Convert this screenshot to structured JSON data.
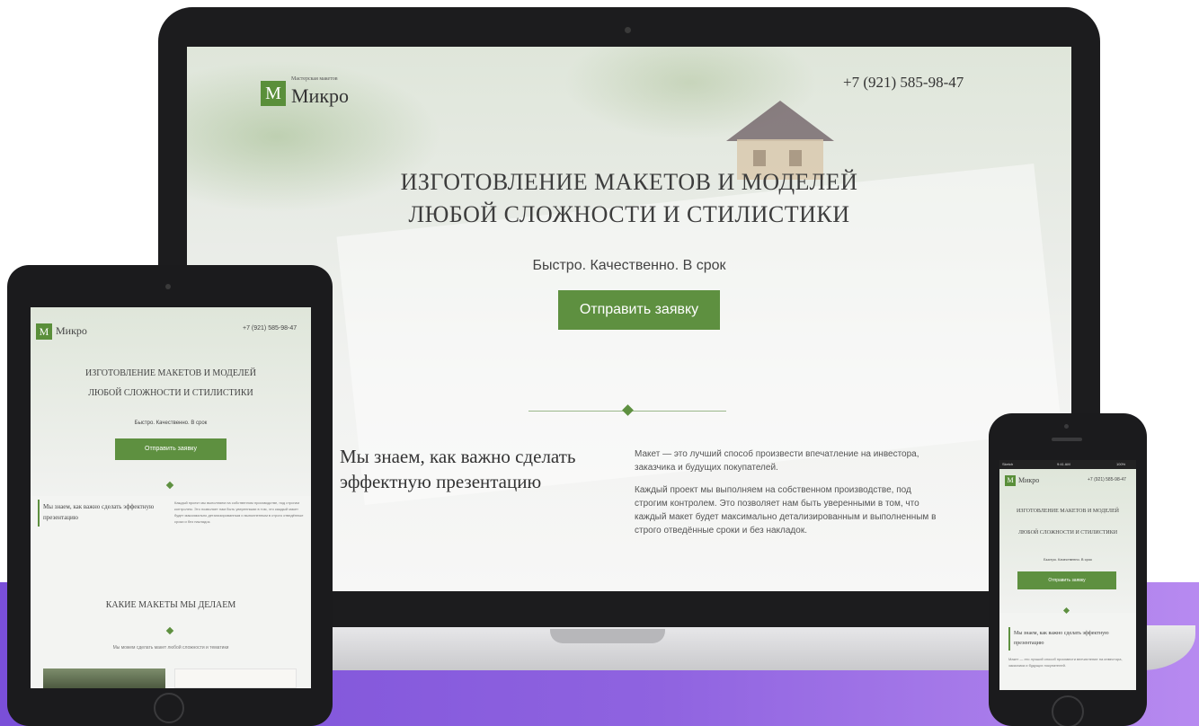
{
  "site": {
    "logo_letter": "M",
    "logo_tagline": "Мастерская макетов",
    "logo_name": "Микро",
    "phone": "+7 (921) 585-98-47",
    "headline_line1": "ИЗГОТОВЛЕНИЕ МАКЕТОВ И МОДЕЛЕЙ",
    "headline_line2": "ЛЮБОЙ СЛОЖНОСТИ И СТИЛИСТИКИ",
    "tagline": "Быстро. Качественно. В срок",
    "cta_label": "Отправить заявку",
    "promo_title": "Мы знаем, как важно сделать эффектную презентацию",
    "promo_p1": "Макет — это лучший способ произвести впечатление на инвестора, заказчика и будущих покупателей.",
    "promo_p2": "Каждый проект мы выполняем на собственном производстве, под строгим контролем. Это позволяет нам быть уверенными в том, что каждый макет будет максимально детализированным и выполненным в строго отведённые сроки и без накладок."
  },
  "tablet": {
    "section_title": "КАКИЕ МАКЕТЫ МЫ ДЕЛАЕМ",
    "section_sub": "Мы можем сделать макет любой сложности и тематики"
  },
  "phone_status": {
    "carrier": "Sketch",
    "time": "9:41 AM",
    "battery": "100%"
  },
  "colors": {
    "accent_green": "#5e9040",
    "band_purple": "#7a4fd8"
  }
}
